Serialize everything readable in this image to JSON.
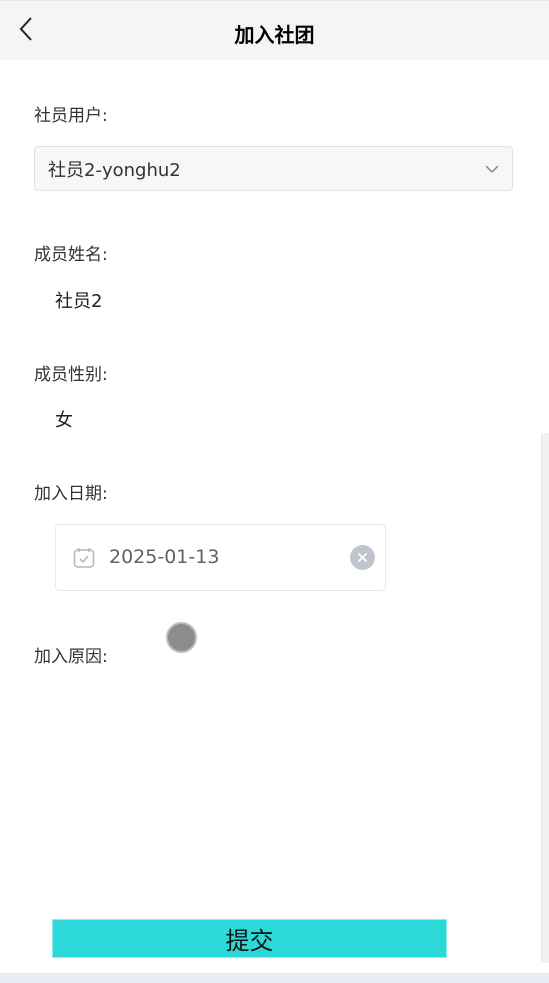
{
  "header": {
    "title": "加入社团"
  },
  "form": {
    "member_user": {
      "label": "社员用户:",
      "value": "社员2-yonghu2"
    },
    "member_name": {
      "label": "成员姓名:",
      "value": "社员2"
    },
    "member_gender": {
      "label": "成员性别:",
      "value": "女"
    },
    "join_date": {
      "label": "加入日期:",
      "value": "2025-01-13"
    },
    "join_reason": {
      "label": "加入原因:",
      "value": ""
    }
  },
  "submit": {
    "label": "提交"
  },
  "colors": {
    "accent": "#2dd8d8",
    "header_bg": "#f5f5f5"
  },
  "icons": [
    "chevron-left-icon",
    "chevron-down-icon",
    "calendar-icon",
    "clear-icon"
  ]
}
